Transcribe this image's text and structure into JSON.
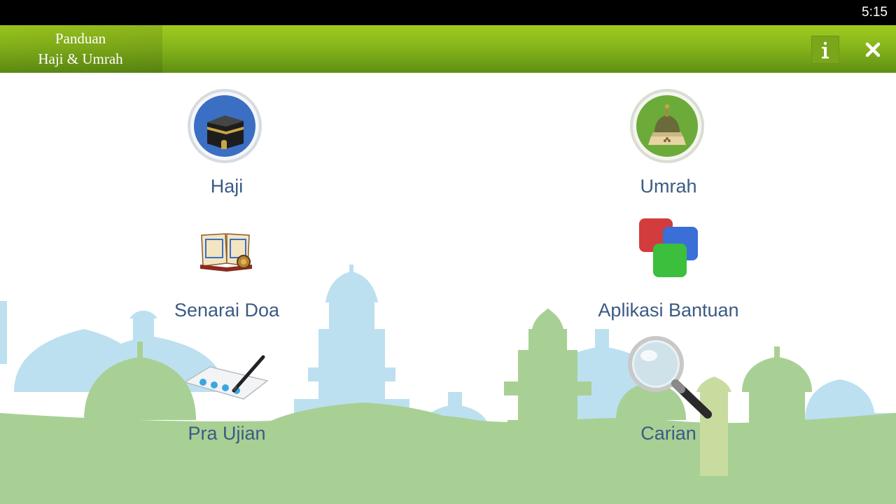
{
  "status_bar": {
    "time": "5:15"
  },
  "app_bar": {
    "title_line1": "Panduan",
    "title_line2": "Haji & Umrah",
    "info_icon": "info-icon",
    "close_icon": "close-icon"
  },
  "menu": {
    "haji": {
      "label": "Haji",
      "icon": "kaaba-icon"
    },
    "umrah": {
      "label": "Umrah",
      "icon": "mosque-dome-icon"
    },
    "senarai_doa": {
      "label": "Senarai Doa",
      "icon": "quran-book-icon"
    },
    "aplikasi_bantuan": {
      "label": "Aplikasi Bantuan",
      "icon": "apps-squares-icon"
    },
    "pra_ujian": {
      "label": "Pra Ujian",
      "icon": "exam-sheet-icon"
    },
    "carian": {
      "label": "Carian",
      "icon": "magnifier-icon"
    }
  },
  "colors": {
    "app_bar": "#86b51a",
    "label_text": "#3b5b84",
    "skyline_blue": "#b7dcef",
    "skyline_green": "#a9d092"
  }
}
